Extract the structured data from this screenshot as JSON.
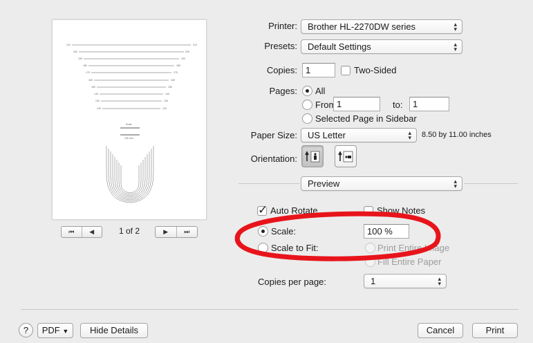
{
  "printer": {
    "label": "Printer:",
    "value": "Brother HL-2270DW series"
  },
  "presets": {
    "label": "Presets:",
    "value": "Default Settings"
  },
  "copies": {
    "label": "Copies:",
    "value": "1",
    "two_sided_label": "Two-Sided"
  },
  "pages": {
    "label": "Pages:",
    "all_label": "All",
    "from_label": "From:",
    "from_value": "1",
    "to_label": "to:",
    "to_value": "1",
    "selected_label": "Selected Page in Sidebar"
  },
  "paper_size": {
    "label": "Paper Size:",
    "value": "US Letter",
    "dimensions": "8.50 by 11.00 inches"
  },
  "orientation": {
    "label": "Orientation:"
  },
  "section_popup": {
    "value": "Preview"
  },
  "preview_options": {
    "auto_rotate_label": "Auto Rotate",
    "show_notes_label": "Show Notes",
    "scale_label": "Scale:",
    "scale_value": "100 %",
    "scale_to_fit_label": "Scale to Fit:",
    "print_entire_image_label": "Print Entire Image",
    "fill_entire_paper_label": "Fill Entire Paper",
    "copies_per_page_label": "Copies per page:",
    "copies_per_page_value": "1"
  },
  "preview_nav": {
    "page_indicator": "1 of 2"
  },
  "footer": {
    "help_label": "?",
    "pdf_label": "PDF",
    "hide_details_label": "Hide Details",
    "cancel_label": "Cancel",
    "print_label": "Print"
  },
  "annotation": {
    "color": "#e8141b"
  }
}
